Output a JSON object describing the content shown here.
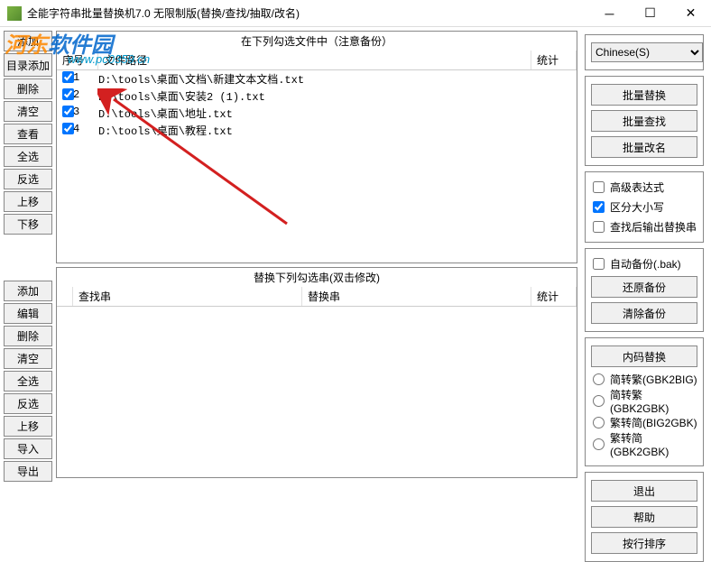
{
  "titlebar": {
    "title": "全能字符串批量替换机7.0 无限制版(替换/查找/抽取/改名)"
  },
  "watermark": {
    "main_orange": "河东",
    "main_blue": "软件园",
    "sub": "www.pc0359.cn"
  },
  "leftTop": [
    "添加",
    "目录添加",
    "删除",
    "清空",
    "查看",
    "全选",
    "反选",
    "上移",
    "下移"
  ],
  "leftBottom": [
    "添加",
    "编辑",
    "删除",
    "清空",
    "全选",
    "反选",
    "上移",
    "导入",
    "导出"
  ],
  "panelTop": {
    "title": "在下列勾选文件中（注意备份）",
    "headers": {
      "num": "序号",
      "path": "文件路径",
      "stat": "统计"
    },
    "rows": [
      {
        "num": "1",
        "path": "D:\\tools\\桌面\\文档\\新建文本文档.txt",
        "checked": true
      },
      {
        "num": "2",
        "path": "D:\\tools\\桌面\\安装2 (1).txt",
        "checked": true
      },
      {
        "num": "3",
        "path": "D:\\tools\\桌面\\地址.txt",
        "checked": true
      },
      {
        "num": "4",
        "path": "D:\\tools\\桌面\\教程.txt",
        "checked": true
      }
    ]
  },
  "panelBottom": {
    "title": "替换下列勾选串(双击修改)",
    "headers": {
      "search": "查找串",
      "replace": "替换串",
      "stat": "统计"
    }
  },
  "right": {
    "language": "Chinese(S)",
    "batchButtons": [
      "批量替换",
      "批量查找",
      "批量改名"
    ],
    "options": {
      "advancedExpr": "高级表达式",
      "caseSensitive": "区分大小写",
      "outputReplace": "查找后输出替换串"
    },
    "backup": {
      "autoBackup": "自动备份(.bak)",
      "restore": "还原备份",
      "clear": "清除备份"
    },
    "encoding": {
      "title": "内码替换",
      "options": [
        "简转繁(GBK2BIG)",
        "简转繁(GBK2GBK)",
        "繁转简(BIG2GBK)",
        "繁转简(GBK2GBK)"
      ]
    },
    "bottomButtons": [
      "退出",
      "帮助",
      "按行排序"
    ]
  }
}
